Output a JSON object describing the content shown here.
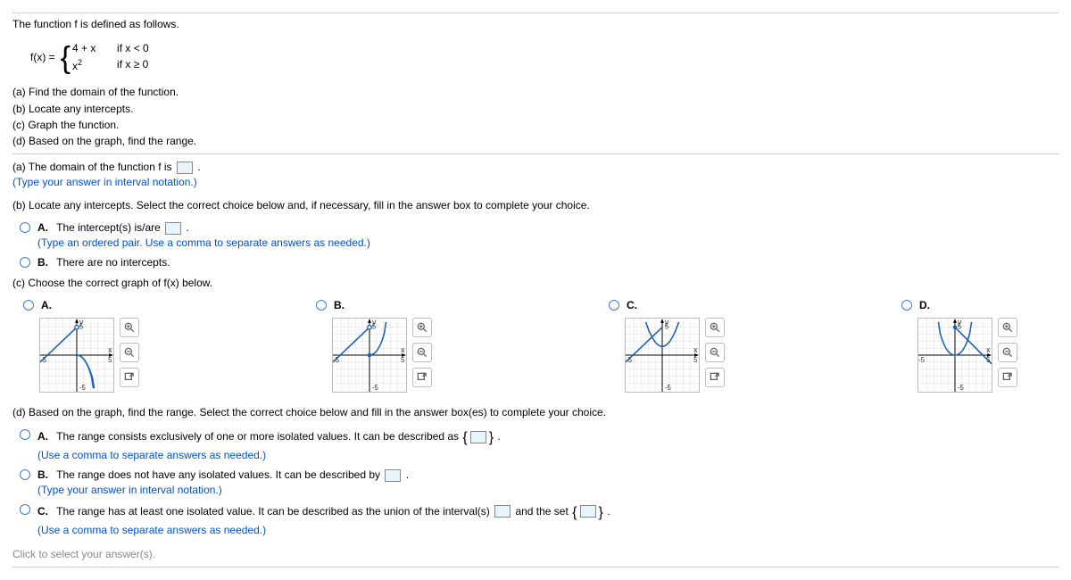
{
  "intro": "The function f is defined as follows.",
  "func": {
    "left": "f(x) = ",
    "case1_expr": "4 + x",
    "case1_cond": "if  x < 0",
    "case2_expr_base": "x",
    "case2_expr_exp": "2",
    "case2_cond": "if  x ≥ 0"
  },
  "tasks": {
    "a": "(a) Find the domain of the function.",
    "b": "(b) Locate any intercepts.",
    "c": "(c) Graph the function.",
    "d": "(d) Based on the graph, find the range."
  },
  "part_a": {
    "text_before": "(a) The domain of the function f is ",
    "text_after": ".",
    "hint": "(Type your answer in interval notation.)"
  },
  "part_b": {
    "prompt": "(b) Locate any intercepts. Select the correct choice below and, if necessary, fill in the answer box to complete your choice.",
    "optA_label": "A.",
    "optA_before": "The intercept(s) is/are ",
    "optA_after": ".",
    "optA_hint": "(Type an ordered pair. Use a comma to separate answers as needed.)",
    "optB_label": "B.",
    "optB_text": "There are no intercepts."
  },
  "part_c": {
    "prompt": "(c) Choose the correct graph of f(x) below.",
    "labels": {
      "A": "A.",
      "B": "B.",
      "C": "C.",
      "D": "D."
    },
    "axis": {
      "y": "y",
      "x": "x",
      "neg5": "-5",
      "pos5": "5"
    }
  },
  "part_d": {
    "prompt": "(d) Based on the graph, find the range. Select the correct choice below and fill in the answer box(es) to complete your choice.",
    "optA_label": "A.",
    "optA_before": "The range consists exclusively of one or more isolated values. It can be described as ",
    "optA_after": ".",
    "optA_hint": "(Use a comma to separate answers as needed.)",
    "optB_label": "B.",
    "optB_before": "The range does not have any isolated values. It can be described by ",
    "optB_after": ".",
    "optB_hint": "(Type your answer in interval notation.)",
    "optC_label": "C.",
    "optC_before": "The range has at least one isolated value. It can be described as the union of the interval(s) ",
    "optC_mid": " and the set ",
    "optC_after": ".",
    "optC_hint": "(Use a comma to separate answers as needed.)"
  },
  "footer": "Click to select your answer(s)."
}
